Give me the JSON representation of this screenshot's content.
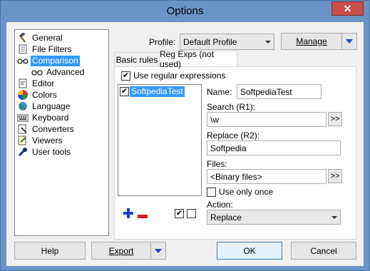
{
  "window": {
    "title": "Options",
    "close_glyph": "✕"
  },
  "tree": {
    "items": [
      {
        "label": "General",
        "icon": "hammer-icon",
        "selected": false,
        "indent": 0
      },
      {
        "label": "File Filters",
        "icon": "document-icon",
        "selected": false,
        "indent": 0
      },
      {
        "label": "Comparison",
        "icon": "glasses-icon",
        "selected": true,
        "indent": 0
      },
      {
        "label": "Advanced",
        "icon": "glasses-icon",
        "selected": false,
        "indent": 1
      },
      {
        "label": "Editor",
        "icon": "editor-icon",
        "selected": false,
        "indent": 0
      },
      {
        "label": "Colors",
        "icon": "colors-icon",
        "selected": false,
        "indent": 0
      },
      {
        "label": "Language",
        "icon": "globe-icon",
        "selected": false,
        "indent": 0
      },
      {
        "label": "Keyboard",
        "icon": "keyboard-icon",
        "selected": false,
        "indent": 0
      },
      {
        "label": "Converters",
        "icon": "converter-icon",
        "selected": false,
        "indent": 0
      },
      {
        "label": "Viewers",
        "icon": "viewer-icon",
        "selected": false,
        "indent": 0
      },
      {
        "label": "User tools",
        "icon": "user-tools-icon",
        "selected": false,
        "indent": 0
      }
    ]
  },
  "profile": {
    "label": "Profile:",
    "value": "Default Profile",
    "manage_label": "Manage"
  },
  "tabs": [
    {
      "label": "Basic rules",
      "active": false
    },
    {
      "label": "Reg Exps (not used)",
      "active": true
    }
  ],
  "regex": {
    "use_regex_label": "Use regular expressions",
    "use_regex_checked": true,
    "list_items": [
      {
        "label": "SoftpediaTest",
        "checked": true
      }
    ],
    "name_label": "Name:",
    "name_value": "SoftpediaTest",
    "search_label": "Search (R1):",
    "search_value": "\\w",
    "replace_label": "Replace (R2):",
    "replace_value": "Softpedia",
    "files_label": "Files:",
    "files_value": "<Binary files>",
    "expand_button": ">>",
    "use_once_label": "Use only once",
    "use_once_checked": false,
    "action_label": "Action:",
    "action_value": "Replace",
    "check_glyph": "✔"
  },
  "footer": {
    "help_label": "Help",
    "export_label": "Export",
    "ok_label": "OK",
    "cancel_label": "Cancel"
  },
  "colors": {
    "accent": "#3399ff",
    "titlebar": "#6c93c6",
    "close": "#c7504b",
    "add": "#1a3fd1",
    "remove": "#d42020"
  }
}
